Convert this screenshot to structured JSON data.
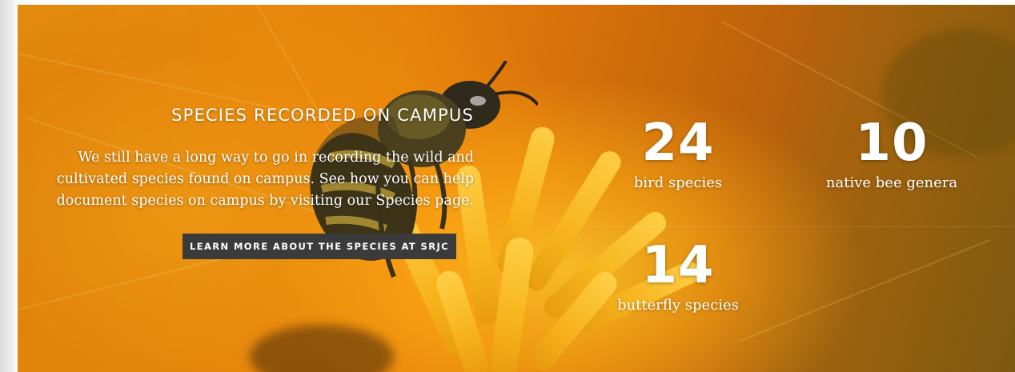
{
  "section": {
    "title": "SPECIES RECORDED ON CAMPUS",
    "description": "We still have a long way to go in recording the wild and cultivated species found on campus. See how you can help document species on campus by visiting our Species page.",
    "cta_label": "LEARN MORE ABOUT THE SPECIES AT SRJC"
  },
  "stats": [
    {
      "value": "24",
      "label": "bird species"
    },
    {
      "value": "10",
      "label": "native bee genera"
    },
    {
      "value": "14",
      "label": "butterfly species"
    }
  ],
  "colors": {
    "button_bg": "#3b3b3b",
    "text": "#ffffff",
    "accent_orange": "#ec8a0c"
  },
  "background_image": "bee-on-california-poppy"
}
